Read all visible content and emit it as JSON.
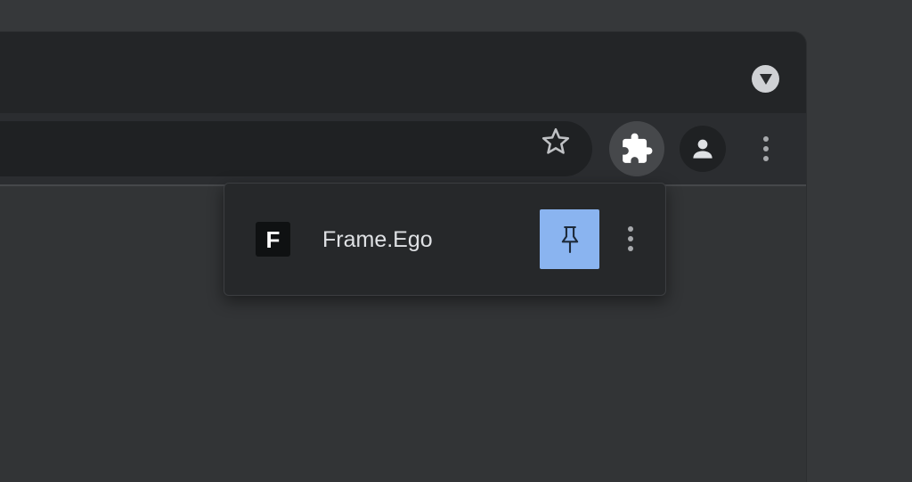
{
  "tab_strip": {
    "tab_search_icon": "triangle-down-icon"
  },
  "toolbar": {
    "bookmark_icon": "star-outline-icon",
    "extensions_icon": "puzzle-piece-icon",
    "profile_icon": "person-icon",
    "menu_icon": "vertical-dots-icon"
  },
  "extensions_menu": {
    "items": [
      {
        "icon_letter": "F",
        "name": "Frame.Ego",
        "pinned": true,
        "pin_icon": "pushpin-icon",
        "more_icon": "vertical-dots-icon"
      }
    ]
  },
  "colors": {
    "tab_strip_bg": "#232527",
    "toolbar_bg": "#2b2d30",
    "omnibox_bg": "#1f2123",
    "popup_bg": "#26282a",
    "pin_active": "#8ab4f0",
    "text": "#dfe1e4"
  }
}
